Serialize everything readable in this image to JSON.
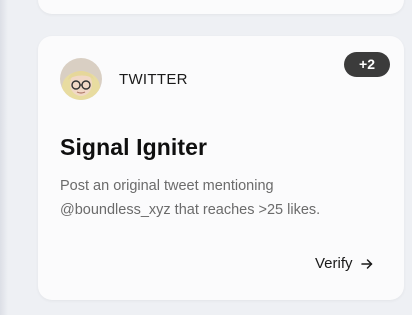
{
  "card": {
    "platform": "TWITTER",
    "extra_count_badge": "+2",
    "title": "Signal Igniter",
    "description": "Post an original tweet mentioning @boundless_xyz that reaches >25 likes.",
    "verify_label": "Verify",
    "avatar_icon": "profile-avatar",
    "verify_icon": "arrow-right-icon"
  },
  "colors": {
    "badge_bg": "#3b3b3b",
    "card_bg": "#fbfbfc",
    "page_bg": "#eef0f4",
    "description_text": "#6b6b6b"
  }
}
